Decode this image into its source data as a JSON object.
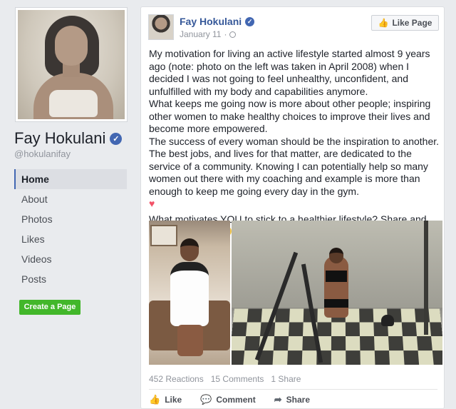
{
  "profile": {
    "name": "Fay Hokulani",
    "handle": "@hokulanifay",
    "verified_mark": "✓"
  },
  "nav": {
    "items": [
      {
        "label": "Home",
        "active": true
      },
      {
        "label": "About",
        "active": false
      },
      {
        "label": "Photos",
        "active": false
      },
      {
        "label": "Likes",
        "active": false
      },
      {
        "label": "Videos",
        "active": false
      },
      {
        "label": "Posts",
        "active": false
      }
    ]
  },
  "create_page_label": "Create a Page",
  "post": {
    "author": "Fay Hokulani",
    "date": "January 11",
    "date_sep": "·",
    "like_page_label": "Like Page",
    "paragraphs": [
      "My motivation for living an active lifestyle started almost 9 years ago (note: photo on the left was taken in April 2008) when I decided I was not going to feel unhealthy, unconfident, and unfulfilled with my body and capabilities anymore.",
      "What keeps me going now is more about other people; inspiring other women to make healthy choices to improve their lives and become more empowered.",
      "The success of every woman should be the inspiration to another. The best jobs, and lives for that matter, are dedicated to the service of a community. Knowing I can potentially help so many women out there with my coaching and example is more than enough to keep me going every day in the gym.",
      "What motivates YOU to stick to a healthier lifestyle? Share and comment below"
    ],
    "heart": "♥",
    "reactions": "452 Reactions",
    "comments": "15 Comments",
    "shares": "1 Share",
    "actions": {
      "like": "Like",
      "comment": "Comment",
      "share": "Share"
    }
  },
  "colors": {
    "brand": "#4267b2",
    "link": "#365899",
    "create_button": "#42b72a",
    "background": "#e9ebee"
  },
  "icons": [
    "verified-badge-icon",
    "globe-icon",
    "thumbs-up-icon",
    "comment-icon",
    "share-arrow-icon",
    "heart-emoji-icon",
    "smile-emoji-icon"
  ]
}
